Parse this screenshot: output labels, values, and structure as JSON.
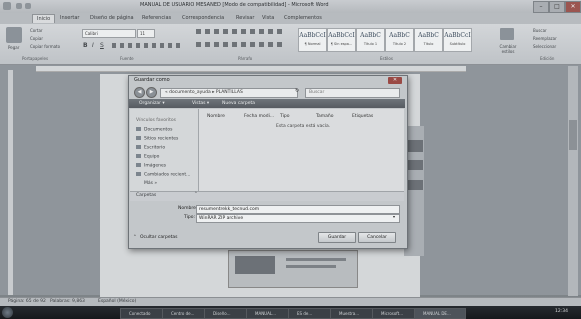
{
  "window": {
    "title": "MANUAL DE USUARIO MESANED [Modo de compatibilidad] - Microsoft Word",
    "controls": [
      "–",
      "□",
      "✕"
    ]
  },
  "ribbon": {
    "tabs": [
      "Inicio",
      "Insertar",
      "Diseño de página",
      "Referencias",
      "Correspondencia",
      "Revisar",
      "Vista",
      "Complementos"
    ],
    "clipboard": {
      "paste": "Pegar",
      "cut": "Cortar",
      "copy": "Copiar",
      "format": "Copiar formato",
      "group": "Portapapeles"
    },
    "font": {
      "name": "Calibri",
      "size": "11",
      "group": "Fuente"
    },
    "paragraph_group": "Párrafo",
    "styles": [
      {
        "sample": "AaBbCcI",
        "name": "¶ Normal"
      },
      {
        "sample": "AaBbCcI",
        "name": "¶ Sin espa..."
      },
      {
        "sample": "AaBbC",
        "name": "Título 1"
      },
      {
        "sample": "AaBbC",
        "name": "Título 2"
      },
      {
        "sample": "AaBbC",
        "name": "Título"
      },
      {
        "sample": "AaBbCcI",
        "name": "Subtítulo"
      }
    ],
    "styles_group": "Estilos",
    "change_styles": "Cambiar estilos",
    "editing": {
      "find": "Buscar",
      "replace": "Reemplazar",
      "select": "Seleccionar",
      "group": "Edición"
    }
  },
  "dialog": {
    "title": "Guardar como",
    "close": "✕",
    "address": "« documento_ayuda ▸ PLANTILLAS",
    "search_placeholder": "Buscar",
    "toolbar": {
      "organize": "Organizar ▾",
      "views": "Vistas ▾",
      "new_folder": "Nueva carpeta"
    },
    "left_header": "Vínculos favoritos",
    "left_items": [
      "Documentos",
      "Sitios recientes",
      "Escritorio",
      "Equipo",
      "Imágenes",
      "Cambiados recient...",
      "Más »"
    ],
    "folders": "Carpetas",
    "columns": [
      "Nombre",
      "Fecha modi...",
      "Tipo",
      "Tamaño",
      "Etiquetas"
    ],
    "empty_message": "Esta carpeta está vacía.",
    "filename_label": "Nombre:",
    "filename_value": "resumentrekk_tecnud.com",
    "type_label": "Tipo:",
    "type_value": "WinRAR ZIP archive",
    "hide_folders": "Ocultar carpetas",
    "save": "Guardar",
    "cancel": "Cancelar"
  },
  "status": {
    "page": "Página: 65 de 92",
    "words": "Palabras: 9,863",
    "language": "Español (México)"
  },
  "taskbar": {
    "items": [
      "Conectado",
      "Centro de...",
      "Diseño...",
      "MANUAL...",
      "ES de...",
      "Muestra...",
      "Microsoft...",
      "MANUAL DE..."
    ],
    "clock": "12:34"
  }
}
